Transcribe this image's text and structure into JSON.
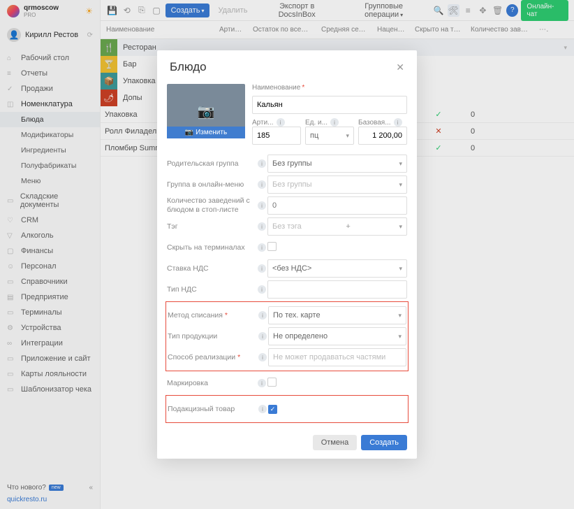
{
  "sidebar": {
    "org": "qrmoscow",
    "plan": "PRO",
    "user": "Кирилл Рестов",
    "nav": [
      {
        "label": "Рабочий стол",
        "icon": "⌂"
      },
      {
        "label": "Отчеты",
        "icon": "≡"
      },
      {
        "label": "Продажи",
        "icon": "✓"
      },
      {
        "label": "Номенклатура",
        "icon": "◫",
        "expanded": true
      },
      {
        "label": "Блюда",
        "sub": true,
        "active": true
      },
      {
        "label": "Модификаторы",
        "sub": true
      },
      {
        "label": "Ингредиенты",
        "sub": true
      },
      {
        "label": "Полуфабрикаты",
        "sub": true
      },
      {
        "label": "Меню",
        "sub": true
      },
      {
        "label": "Складские документы",
        "icon": "▭"
      },
      {
        "label": "CRM",
        "icon": "♡"
      },
      {
        "label": "Алкоголь",
        "icon": "▽"
      },
      {
        "label": "Финансы",
        "icon": "▢"
      },
      {
        "label": "Персонал",
        "icon": "☺"
      },
      {
        "label": "Справочники",
        "icon": "▭"
      },
      {
        "label": "Предприятие",
        "icon": "▤"
      },
      {
        "label": "Терминалы",
        "icon": "▭"
      },
      {
        "label": "Устройства",
        "icon": "⚙"
      },
      {
        "label": "Интеграции",
        "icon": "∞"
      },
      {
        "label": "Приложение и сайт",
        "icon": "▭"
      },
      {
        "label": "Карты лояльности",
        "icon": "▭"
      },
      {
        "label": "Шаблонизатор чека",
        "icon": "▭"
      }
    ],
    "whats_new": "Что нового?",
    "new_badge": "new",
    "link": "quickresto.ru"
  },
  "toolbar": {
    "create": "Создать",
    "delete": "Удалить",
    "export": "Экспорт в DocsInBox",
    "group_ops": "Групповые операции",
    "online_chat": "Онлайн-чат"
  },
  "table": {
    "headers": [
      "Наименование",
      "Артикул",
      "Остаток по всем склада...",
      "Средняя себесто...",
      "Наценка, %",
      "Скрыто на терминалах",
      "Количество заведени..."
    ],
    "tree": [
      {
        "label": "Ресторан",
        "color": "green",
        "icon": "🍴"
      },
      {
        "label": "Бар",
        "color": "yellow",
        "icon": "🍸"
      },
      {
        "label": "Упаковка",
        "color": "teal",
        "icon": "📦"
      },
      {
        "label": "Допы",
        "color": "red",
        "icon": "🌶"
      }
    ],
    "rows": [
      {
        "name": "Упаковка",
        "hidden": "✓",
        "count": "0"
      },
      {
        "name": "Ролл Филадельфи...",
        "hidden": "✕",
        "count": "0"
      },
      {
        "name": "Пломбир Summer...",
        "hidden": "✓",
        "count": "0"
      }
    ]
  },
  "modal": {
    "title": "Блюдо",
    "change_img": "Изменить",
    "name_label": "Наименование",
    "name_value": "Кальян",
    "sku_label": "Арти...",
    "sku_value": "185",
    "unit_label": "Ед. и...",
    "unit_value": "пц",
    "price_label": "Базовая...",
    "price_value": "1 200,00",
    "fields": {
      "parent_group": {
        "label": "Родительская группа",
        "value": "Без группы"
      },
      "online_group": {
        "label": "Группа в онлайн-меню",
        "placeholder": "Без группы"
      },
      "stop_count": {
        "label": "Количество заведений с блюдом в стоп-листе",
        "placeholder": "0"
      },
      "tag": {
        "label": "Тэг",
        "placeholder": "Без тэга"
      },
      "hide_terminals": {
        "label": "Скрыть на терминалах"
      },
      "vat_rate": {
        "label": "Ставка НДС",
        "value": "<без НДС>"
      },
      "vat_type": {
        "label": "Тип НДС"
      },
      "writeoff": {
        "label": "Метод списания",
        "value": "По тех. карте"
      },
      "prod_type": {
        "label": "Тип продукции",
        "value": "Не определено"
      },
      "sale_method": {
        "label": "Способ реализации",
        "placeholder": "Не может продаваться частями"
      },
      "marking": {
        "label": "Маркировка"
      },
      "excise": {
        "label": "Подакцизный товар"
      }
    },
    "cancel": "Отмена",
    "submit": "Создать"
  }
}
